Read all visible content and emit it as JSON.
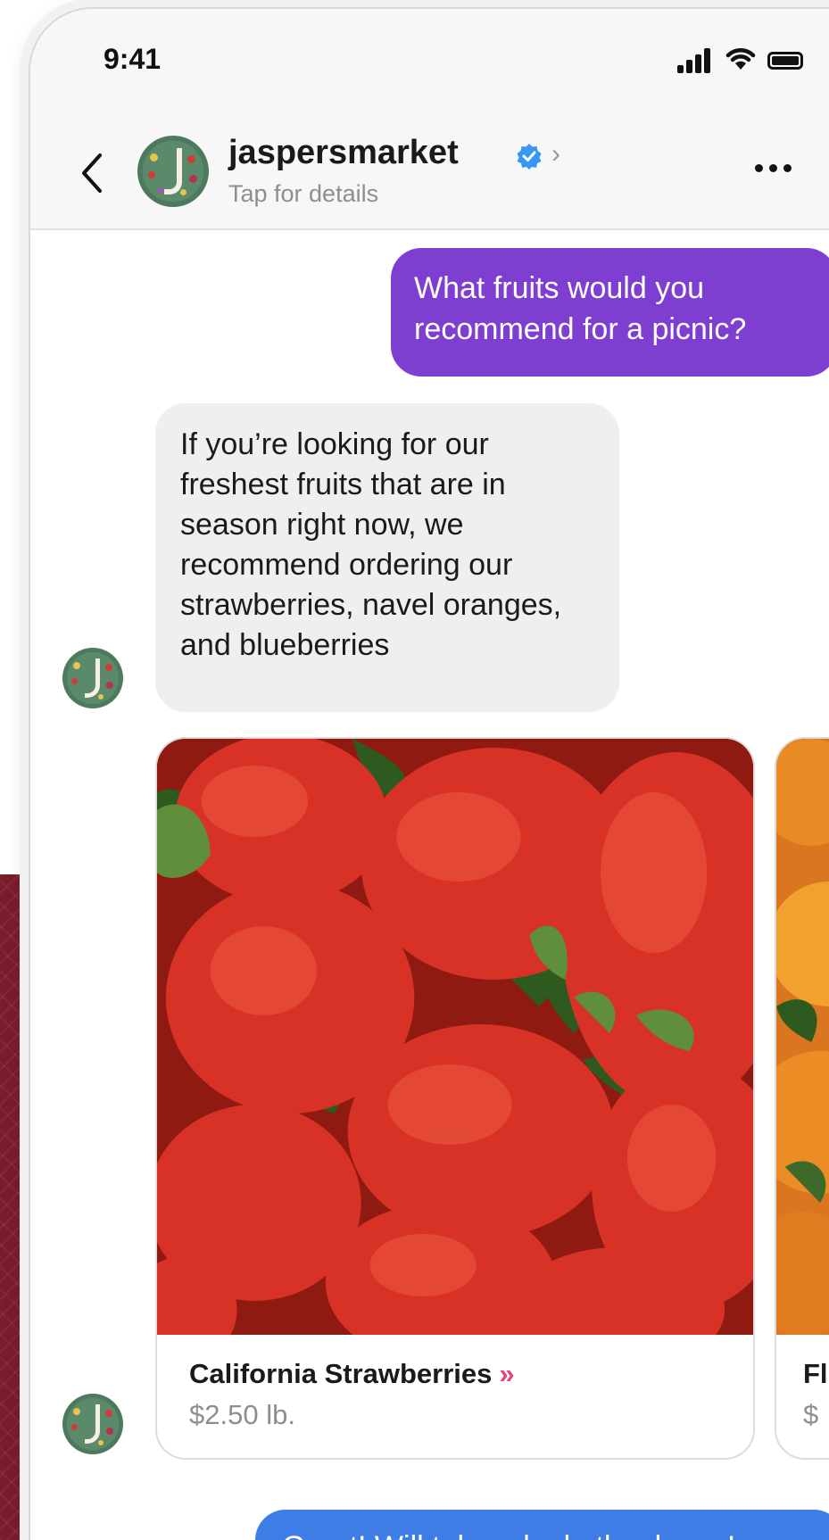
{
  "status_bar": {
    "time": "9:41"
  },
  "header": {
    "username": "jaspersmarket",
    "subtitle": "Tap for details",
    "verified_icon": "verified-badge-icon",
    "back_icon": "chevron-left-icon",
    "more_icon": "more-horizontal-icon"
  },
  "messages": [
    {
      "from": "user",
      "text": "What fruits would you recommend for a picnic?"
    },
    {
      "from": "business",
      "text": "If you’re looking for our freshest fruits that are in season right now, we recommend ordering our strawberries, navel oranges, and blueberries"
    },
    {
      "from": "user",
      "text": "Great! Will take a look, thank you!"
    }
  ],
  "carousel": [
    {
      "title": "California Strawberries",
      "chevron": "»",
      "price": "$2.50 lb."
    },
    {
      "title": "Fl",
      "price": "$"
    }
  ],
  "colors": {
    "outgoing_purple": "#7e3fd0",
    "incoming_gray": "#efefef",
    "outgoing_blue": "#3e7ce6",
    "verified_blue": "#3897f0",
    "chevron_pink": "#e0457b"
  }
}
